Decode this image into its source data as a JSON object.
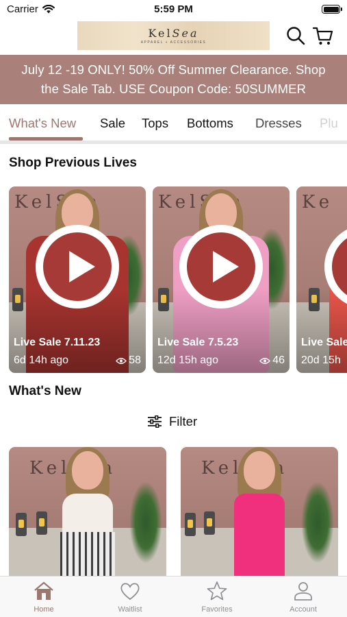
{
  "status_bar": {
    "carrier": "Carrier",
    "time": "5:59 PM"
  },
  "header": {
    "logo_text": "KelSea",
    "logo_tagline": "APPAREL + ACCESSORIES"
  },
  "promo_banner": {
    "line1": "July 12 -19 ONLY! 50% Off Summer Clearance.  Shop",
    "line2": "the Sale Tab.  USE Coupon Code: 50SUMMER"
  },
  "category_tabs": [
    {
      "label": "What's New",
      "active": true
    },
    {
      "label": "Sale"
    },
    {
      "label": "Tops"
    },
    {
      "label": "Bottoms"
    },
    {
      "label": "Dresses"
    },
    {
      "label": "Plu"
    }
  ],
  "previous_lives": {
    "title": "Shop Previous Lives",
    "items": [
      {
        "title": "Live Sale 7.11.23",
        "ago": "6d 14h ago",
        "views": "58",
        "outfit_color": "#a8342f"
      },
      {
        "title": "Live Sale 7.5.23",
        "ago": "12d 15h ago",
        "views": "46",
        "outfit_color": "#ef9ec4"
      },
      {
        "title": "Live Sale",
        "ago": "20d 15h",
        "views": "",
        "outfit_color": "#e8554a"
      }
    ]
  },
  "whats_new": {
    "title": "What's New",
    "filter_label": "Filter"
  },
  "tab_bar": [
    {
      "label": "Home",
      "icon": "home-icon",
      "active": true
    },
    {
      "label": "Waitlist",
      "icon": "heart-icon"
    },
    {
      "label": "Favorites",
      "icon": "star-icon"
    },
    {
      "label": "Account",
      "icon": "person-icon"
    }
  ],
  "colors": {
    "accent": "#9c7770",
    "promo_bg": "#a9807a",
    "play_button": "#a53a37"
  }
}
